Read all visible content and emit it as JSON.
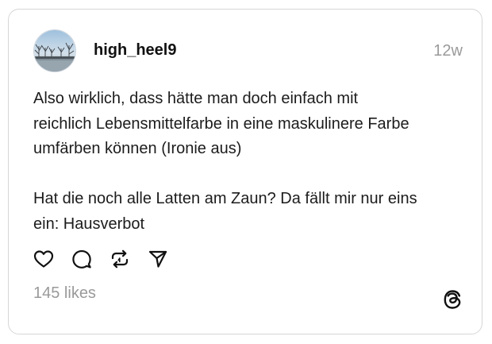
{
  "post": {
    "username": "high_heel9",
    "timestamp": "12w",
    "paragraph_1": "Also wirklich, dass hätte man doch einfach mit\nreichlich Lebensmittelfarbe in eine maskulinere Farbe\numfärben können (Ironie aus)",
    "paragraph_2": "Hat die noch alle Latten am Zaun? Da fällt mir nur eins\nein: Hausverbot",
    "likes": "145 likes"
  },
  "icons": {
    "like": "heart-icon",
    "comment": "speech-bubble-icon",
    "repost": "repost-arrows-icon",
    "share": "paper-plane-icon",
    "brand": "threads-logo-icon"
  },
  "colors": {
    "text": "#1c1c1c",
    "muted": "#9a9a9a",
    "border": "#d6d6d6"
  }
}
